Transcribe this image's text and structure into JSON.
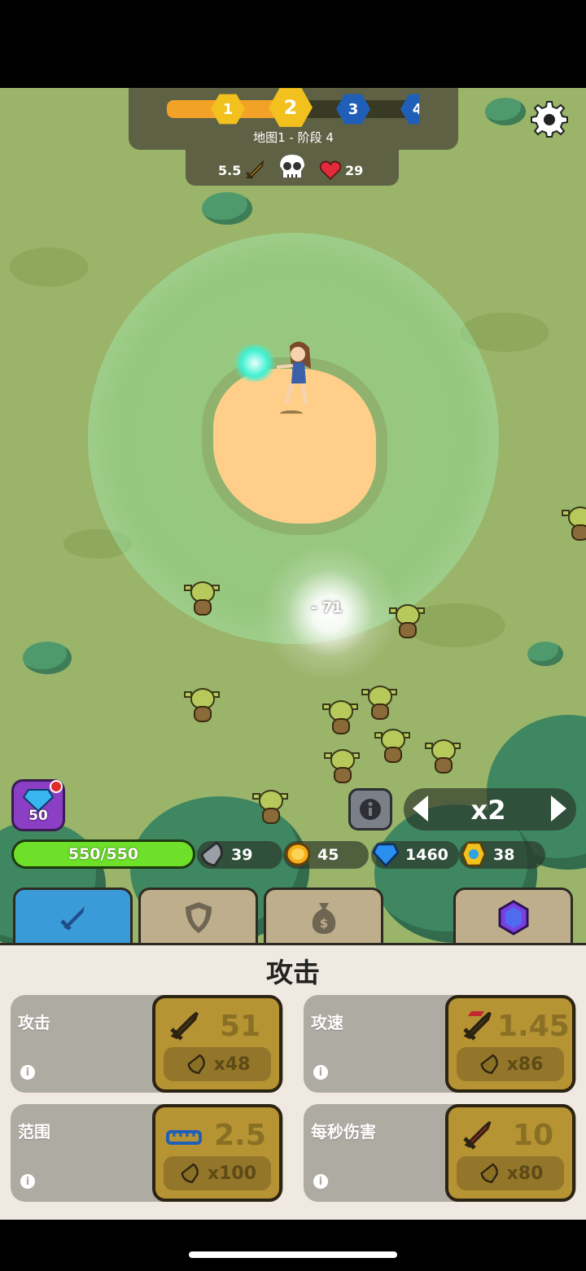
{
  "stage": {
    "nodes": [
      "1",
      "2",
      "3",
      "4"
    ],
    "current_node": "2",
    "label": "地图1 - 阶段 4"
  },
  "battle_stats": {
    "attack_power": "5.5",
    "lives": "29"
  },
  "damage_popup": "- 71",
  "gem_button": {
    "count": "50"
  },
  "speed": {
    "label": "x2"
  },
  "hp": {
    "text": "550/550"
  },
  "resources": {
    "stone": "39",
    "gold": "45",
    "diamond": "1460",
    "coin": "38"
  },
  "tabs": [
    {
      "icon": "sword-icon",
      "active": true
    },
    {
      "icon": "shield-icon",
      "active": false
    },
    {
      "icon": "money-bag-icon",
      "active": false
    },
    {
      "icon": "purple-gem-icon",
      "active": false
    }
  ],
  "panel": {
    "title": "攻击",
    "cards": [
      {
        "label": "攻击",
        "value": "51",
        "cost": "x48",
        "icon": "sword-icon"
      },
      {
        "label": "攻速",
        "value": "1.45",
        "cost": "x86",
        "icon": "fast-sword-icon"
      },
      {
        "label": "范围",
        "value": "2.5",
        "cost": "x100",
        "icon": "ruler-icon"
      },
      {
        "label": "每秒伤害",
        "value": "10",
        "cost": "x80",
        "icon": "red-sword-icon"
      }
    ]
  },
  "colors": {
    "progress": "#f2a226",
    "node_done": "#f2c11e",
    "node_future": "#1f5fb8",
    "hp": "#6ee02a",
    "tab_active": "#3b9bd8",
    "upgrade": "#b69434"
  }
}
